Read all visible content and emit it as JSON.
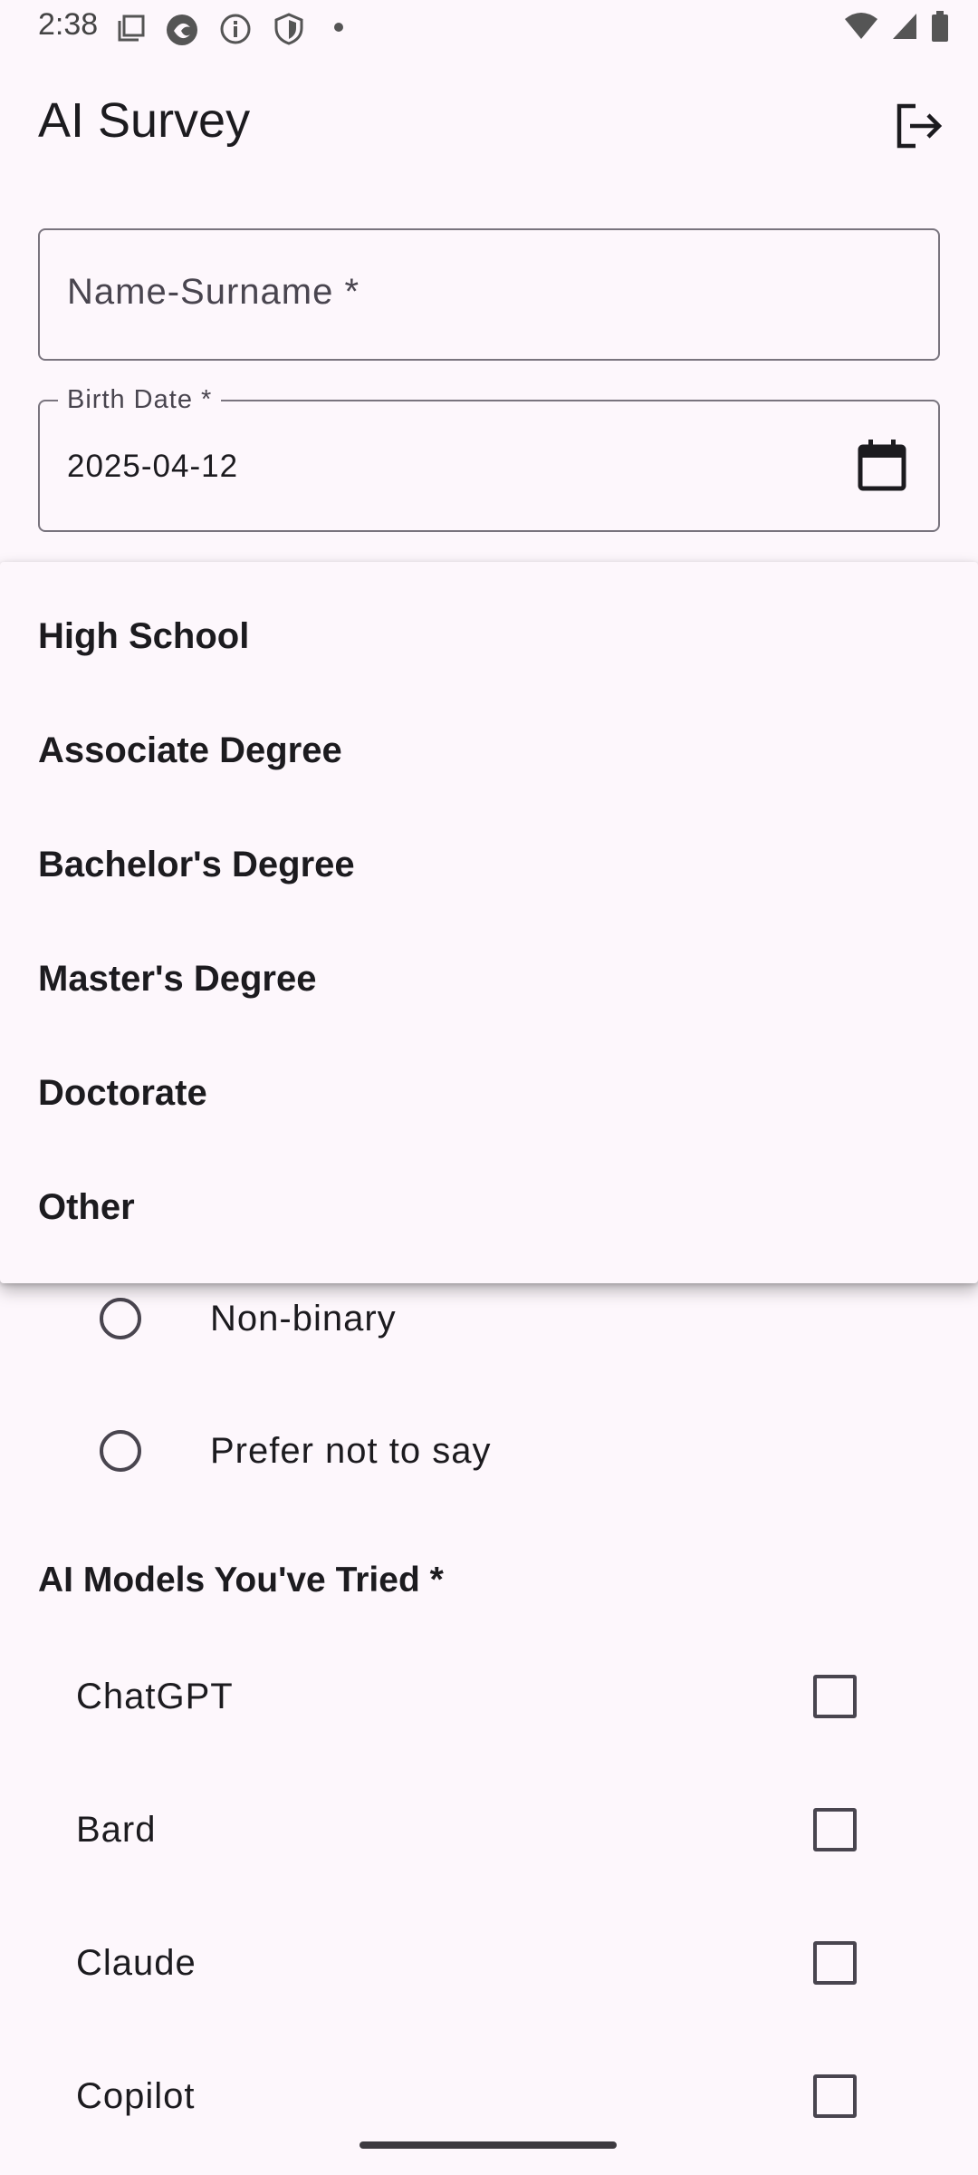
{
  "status_bar": {
    "time": "2:38"
  },
  "app_bar": {
    "title": "AI Survey"
  },
  "form": {
    "name_field": {
      "placeholder": "Name-Surname *"
    },
    "birth_date_field": {
      "label": "Birth Date *",
      "value": "2025-04-12"
    }
  },
  "education_menu": {
    "options": [
      "High School",
      "Associate Degree",
      "Bachelor's Degree",
      "Master's Degree",
      "Doctorate",
      "Other"
    ]
  },
  "gender_options": [
    "Non-binary",
    "Prefer not to say"
  ],
  "ai_models": {
    "heading": "AI Models You've Tried *",
    "options": [
      "ChatGPT",
      "Bard",
      "Claude",
      "Copilot"
    ]
  }
}
